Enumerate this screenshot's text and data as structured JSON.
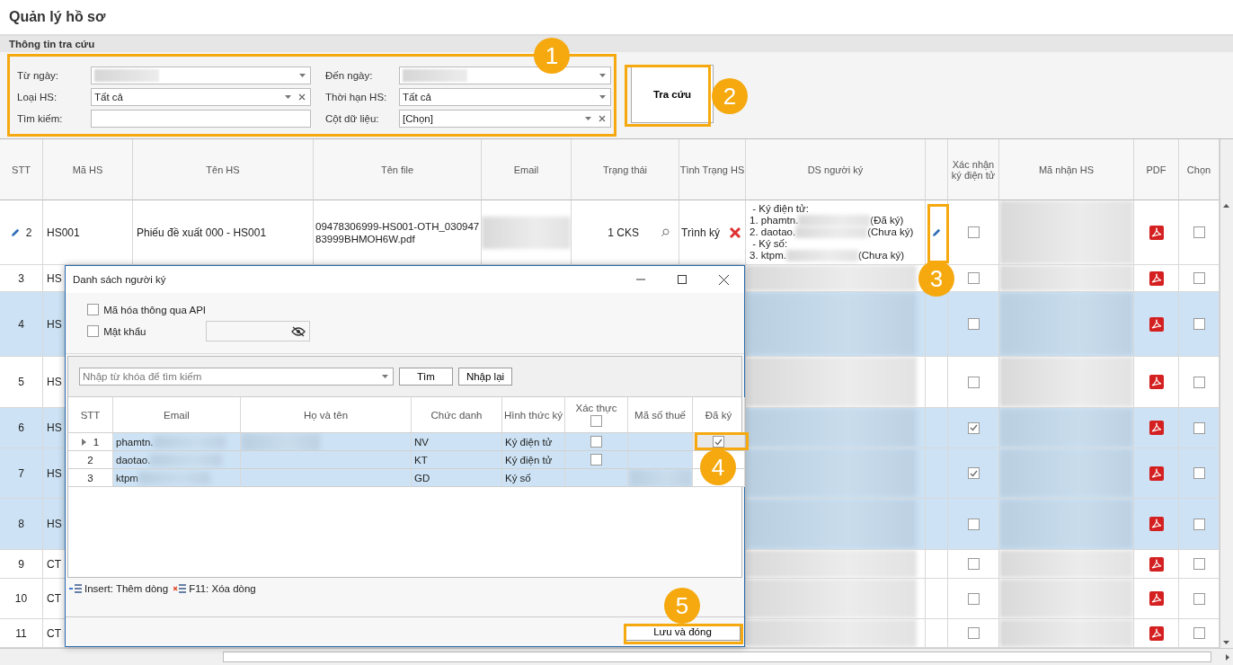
{
  "window": {
    "title": "Quản lý hồ sơ"
  },
  "search_panel": {
    "title": "Thông tin tra cứu",
    "fields": [
      {
        "label": "Từ ngày:",
        "kind": "dropdown-redacted"
      },
      {
        "label": "Đến ngày:",
        "kind": "dropdown-redacted"
      },
      {
        "label": "Loại HS:",
        "kind": "dropdown-clear",
        "value": "Tất cả"
      },
      {
        "label": "Thời hạn HS:",
        "kind": "dropdown",
        "value": "Tất cả"
      },
      {
        "label": "Tìm kiếm:",
        "kind": "text"
      },
      {
        "label": "Cột dữ liệu:",
        "kind": "dropdown-clear",
        "value": "[Chọn]"
      }
    ],
    "search_button": "Tra cứu"
  },
  "table": {
    "columns": [
      "STT",
      "Mã HS",
      "Tên HS",
      "Tên file",
      "Email",
      "Trạng thái",
      "Tình Trạng HS",
      "DS người ký",
      "",
      "Xác nhận ký điện tử",
      "Mã nhận HS",
      "PDF",
      "Chọn"
    ],
    "rows": [
      {
        "stt": "2",
        "ma_hs": "HS001",
        "focused": true,
        "selected": false,
        "ten_hs": "Phiếu đề xuất 000 - HS001",
        "ten_file": "09478306999-HS001-OTH_03094783999BHMOH6W.pdf",
        "trang_thai": "1 CKS",
        "tinh_trang": "Trình ký",
        "signer_groups": [
          {
            "heading": "- Ký điện tử:",
            "entries": [
              {
                "name": "1. phamtn.",
                "status": "(Đã ký)"
              },
              {
                "name": "2. daotao.",
                "status": "(Chưa ký)"
              }
            ]
          },
          {
            "heading": "- Ký số:",
            "entries": [
              {
                "name": "3. ktpm.",
                "status": "(Chưa ký)"
              }
            ]
          }
        ],
        "confirmed": false,
        "chosen": false
      },
      {
        "stt": "3",
        "ma_hs": "HS",
        "focused": false,
        "selected": false,
        "confirmed": false,
        "chosen": false
      },
      {
        "stt": "4",
        "ma_hs": "HS",
        "focused": false,
        "selected": true,
        "confirmed": false,
        "chosen": false
      },
      {
        "stt": "5",
        "ma_hs": "HS",
        "focused": false,
        "selected": false,
        "confirmed": false,
        "chosen": false
      },
      {
        "stt": "6",
        "ma_hs": "HS",
        "focused": false,
        "selected": true,
        "confirmed": true,
        "chosen": false
      },
      {
        "stt": "7",
        "ma_hs": "HS",
        "focused": false,
        "selected": true,
        "confirmed": true,
        "chosen": false
      },
      {
        "stt": "8",
        "ma_hs": "HS",
        "focused": false,
        "selected": true,
        "confirmed": false,
        "chosen": false
      },
      {
        "stt": "9",
        "ma_hs": "CT",
        "focused": false,
        "selected": false,
        "confirmed": false,
        "chosen": false
      },
      {
        "stt": "10",
        "ma_hs": "CT",
        "focused": false,
        "selected": false,
        "confirmed": false,
        "chosen": false
      },
      {
        "stt": "11",
        "ma_hs": "CT",
        "focused": false,
        "selected": false,
        "confirmed": false,
        "chosen": false
      }
    ]
  },
  "dialog": {
    "title": "Danh sách người ký",
    "options": [
      {
        "label": "Mã hóa thông qua API",
        "checked": false
      },
      {
        "label": "Mật khẩu",
        "checked": false
      }
    ],
    "search": {
      "placeholder": "Nhập từ khóa để tìm kiếm"
    },
    "buttons": [
      "Tìm",
      "Nhập lại"
    ],
    "columns": [
      "STT",
      "Email",
      "Họ và tên",
      "Chức danh",
      "Hình thức ký",
      "Xác thực",
      "Mã số thuế",
      "Đã ký"
    ],
    "header_verified_checked": false,
    "rows": [
      {
        "stt": "1",
        "email": "phamtn.",
        "title": "NV",
        "method": "Ký điện tử",
        "focused": true,
        "verified": false,
        "signed": true
      },
      {
        "stt": "2",
        "email": "daotao.",
        "title": "KT",
        "method": "Ký điện tử",
        "focused": false,
        "verified": false
      },
      {
        "stt": "3",
        "email": "ktpm",
        "title": "GD",
        "method": "Ký số",
        "focused": false
      }
    ],
    "hints": [
      "Insert: Thêm dòng",
      "F11: Xóa dòng"
    ],
    "save_button": "Lưu và đóng"
  },
  "annotations": [
    {
      "label": "1"
    },
    {
      "label": "2"
    },
    {
      "label": "3"
    },
    {
      "label": "4"
    },
    {
      "label": "5"
    }
  ]
}
